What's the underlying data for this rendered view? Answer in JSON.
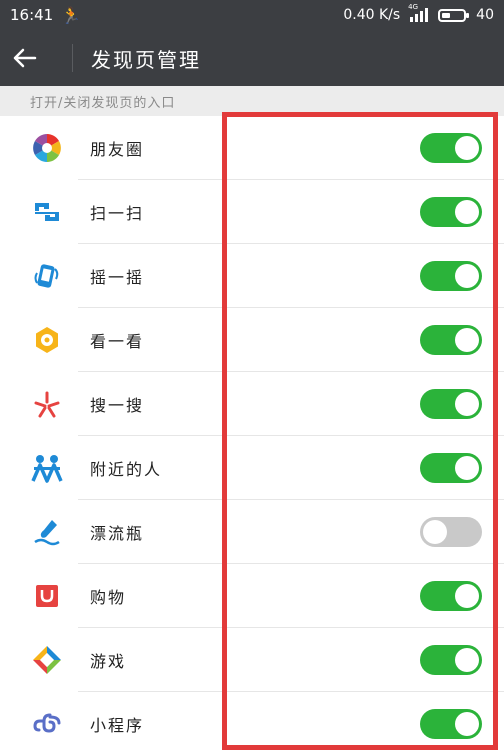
{
  "status": {
    "time": "16:41",
    "network_speed": "0.40 K/s",
    "network_type": "4G",
    "battery": "40",
    "battery_level_percent": 40
  },
  "header": {
    "title": "发现页管理"
  },
  "section": {
    "label": "打开/关闭发现页的入口"
  },
  "items": [
    {
      "label": "朋友圈",
      "enabled": true,
      "icon": "moments-icon"
    },
    {
      "label": "扫一扫",
      "enabled": true,
      "icon": "scan-icon"
    },
    {
      "label": "摇一摇",
      "enabled": true,
      "icon": "shake-icon"
    },
    {
      "label": "看一看",
      "enabled": true,
      "icon": "top-stories-icon"
    },
    {
      "label": "搜一搜",
      "enabled": true,
      "icon": "search-icon"
    },
    {
      "label": "附近的人",
      "enabled": true,
      "icon": "people-nearby-icon"
    },
    {
      "label": "漂流瓶",
      "enabled": false,
      "icon": "drift-bottle-icon"
    },
    {
      "label": "购物",
      "enabled": true,
      "icon": "shopping-icon"
    },
    {
      "label": "游戏",
      "enabled": true,
      "icon": "games-icon"
    },
    {
      "label": "小程序",
      "enabled": true,
      "icon": "mini-programs-icon"
    }
  ],
  "colors": {
    "toggle_on": "#2bb33a",
    "toggle_off": "#c9c9c9",
    "highlight": "#e23a3a",
    "header_bg": "#3c3e42"
  }
}
